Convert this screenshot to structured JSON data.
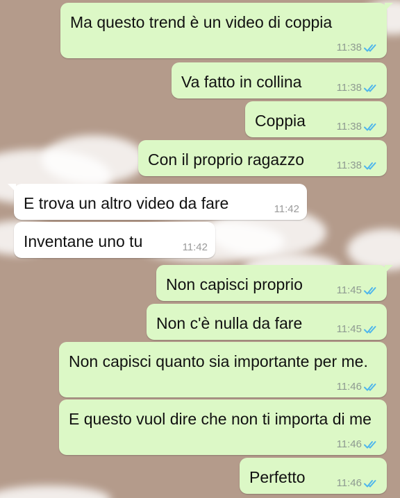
{
  "chat": {
    "messages": [
      {
        "text": "Ma questo trend è un video di coppia",
        "time": "11:38",
        "direction": "outgoing",
        "status": "read"
      },
      {
        "text": "Va fatto in collina",
        "time": "11:38",
        "direction": "outgoing",
        "status": "read"
      },
      {
        "text": "Coppia",
        "time": "11:38",
        "direction": "outgoing",
        "status": "read"
      },
      {
        "text": "Con il proprio ragazzo",
        "time": "11:38",
        "direction": "outgoing",
        "status": "read"
      },
      {
        "text": "E trova un altro video da fare",
        "time": "11:42",
        "direction": "incoming"
      },
      {
        "text": "Inventane uno tu",
        "time": "11:42",
        "direction": "incoming"
      },
      {
        "text": "Non capisci proprio",
        "time": "11:45",
        "direction": "outgoing",
        "status": "read"
      },
      {
        "text": "Non c'è nulla da fare",
        "time": "11:45",
        "direction": "outgoing",
        "status": "read"
      },
      {
        "text": "Non capisci quanto sia importante per me.",
        "time": "11:46",
        "direction": "outgoing",
        "status": "read"
      },
      {
        "text": "E questo vuol dire che non ti importa di me",
        "time": "11:46",
        "direction": "outgoing",
        "status": "read"
      },
      {
        "text": "Perfetto",
        "time": "11:46",
        "direction": "outgoing",
        "status": "read"
      }
    ]
  },
  "colors": {
    "outgoing_bubble": "#dcf8c6",
    "incoming_bubble": "#ffffff",
    "read_ticks": "#4fb6ec",
    "wallpaper": "#b49b8b"
  },
  "icons": {
    "read_status": "double-check-icon"
  }
}
